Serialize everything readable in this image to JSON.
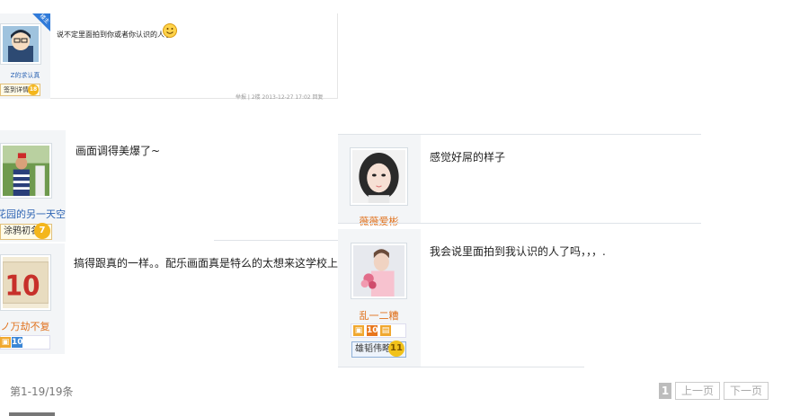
{
  "posts": [
    {
      "user": "Z的求认真",
      "sign_button": "签到详情",
      "level": "18",
      "content": "说不定里面拍到你或者你认识的人了",
      "emoji": "smile-emoji",
      "corner_badge": "楼主",
      "meta": "举报 | 2楼 2013-12-27 17:02 回复"
    },
    {
      "user": "花园的另一天空",
      "level_title": "涂鸦初名",
      "level": "7",
      "content": "画面调得美爆了~"
    },
    {
      "user": "ノ万劫不复",
      "content": "搞得跟真的一样。。配乐画面真是特么的太想来这学校上大学了！"
    },
    {
      "user": "薇薇爱彬",
      "content": "感觉好屌的样子"
    },
    {
      "user": "乱一二糟",
      "level_title": "雄韬伟略",
      "level": "11",
      "content": "我会说里面拍到我认识的人了吗，，，."
    }
  ],
  "pager": {
    "summary": "第1-19/19条",
    "current_page": "1",
    "prev_label": "上一页",
    "next_label": "下一页"
  },
  "colors": {
    "link_blue": "#2d64b3",
    "name_orange": "#e0711c",
    "level_gold": "#f4b61c"
  }
}
